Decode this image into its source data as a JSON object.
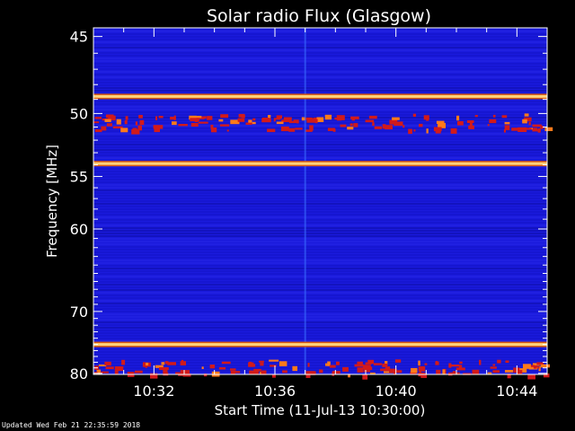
{
  "chart_data": {
    "type": "heatmap",
    "title": "Solar radio Flux (Glasgow)",
    "xlabel": "Start Time (11-Jul-13 10:30:00)",
    "ylabel": "Frequency [MHz]",
    "x_ticks": [
      "10:32",
      "10:36",
      "10:40",
      "10:44"
    ],
    "x_tick_minutes": [
      2,
      6,
      10,
      14
    ],
    "xlim_minutes": [
      0,
      15
    ],
    "y_ticks": [
      45,
      50,
      55,
      60,
      70,
      80
    ],
    "ylim": [
      44.5,
      80.2
    ],
    "background_color": "#1a1adc",
    "bright_lines_mhz": [
      48.8,
      53.9,
      75.0
    ],
    "bright_line_color": "#ffd27a",
    "noisy_bands_mhz": [
      [
        50.0,
        51.2
      ],
      [
        77.5,
        80.2
      ]
    ],
    "noise_color": "#d21a1a",
    "vertical_streak_minute": 7.0
  },
  "footer": "Updated Wed Feb 21 22:35:59 2018"
}
